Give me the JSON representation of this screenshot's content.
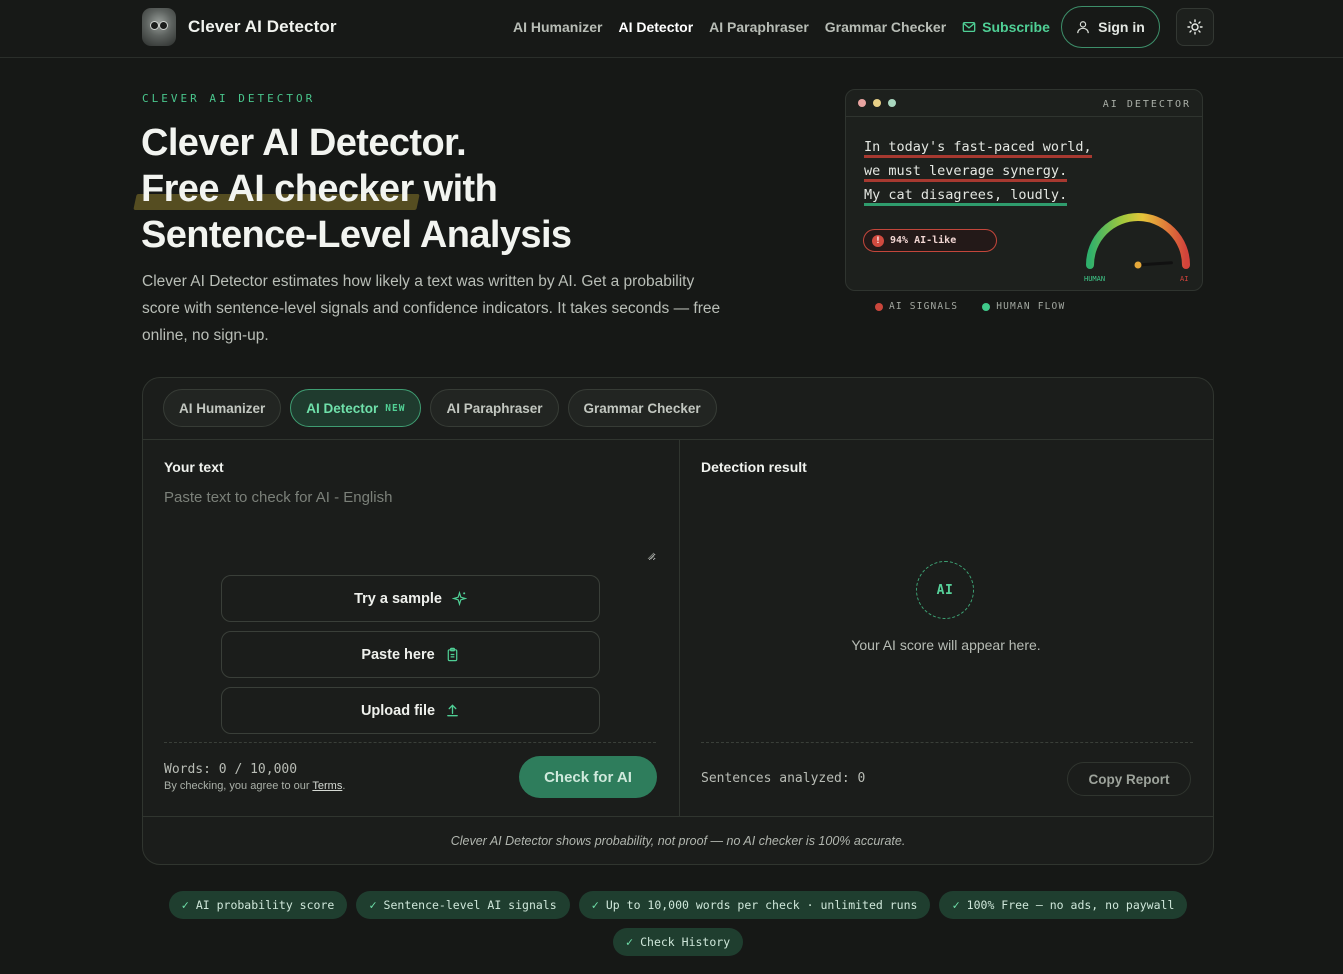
{
  "header": {
    "brand": "Clever AI Detector",
    "nav": [
      {
        "label": "AI Humanizer",
        "active": false
      },
      {
        "label": "AI Detector",
        "active": true
      },
      {
        "label": "AI Paraphraser",
        "active": false
      },
      {
        "label": "Grammar Checker",
        "active": false
      }
    ],
    "subscribe": "Subscribe",
    "sign_in": "Sign in",
    "theme_icon": "sun-icon"
  },
  "hero": {
    "eyebrow": "CLEVER AI DETECTOR",
    "title_line1": "Clever AI Detector.",
    "title_line2_highlight": "Free AI checker",
    "title_line2_rest": " with",
    "title_line3": "Sentence-Level Analysis",
    "description": "Clever AI Detector estimates how likely a text was written by AI. Get a probability score with sentence-level signals and confidence indicators. It takes seconds — free online, no sign-up."
  },
  "preview": {
    "label": "AI DETECTOR",
    "dot_colors": [
      "#e8a3a0",
      "#e7cf86",
      "#a9d7bf"
    ],
    "lines": [
      {
        "text": "In today's fast-paced world,",
        "signal": "ai"
      },
      {
        "text": "we must leverage synergy.",
        "signal": "ai"
      },
      {
        "text": "My cat disagrees, loudly.",
        "signal": "human"
      }
    ],
    "badge": "94% AI-like",
    "badge_icon": "!",
    "gauge": {
      "value": 0.94,
      "left_label": "HUMAN",
      "right_label": "AI"
    },
    "legend": [
      {
        "label": "AI SIGNALS",
        "color": "#c9463b"
      },
      {
        "label": "HUMAN FLOW",
        "color": "#3fc98a"
      }
    ]
  },
  "tool": {
    "tabs": [
      {
        "label": "AI Humanizer",
        "active": false,
        "badge": ""
      },
      {
        "label": "AI Detector",
        "active": true,
        "badge": "NEW"
      },
      {
        "label": "AI Paraphraser",
        "active": false,
        "badge": ""
      },
      {
        "label": "Grammar Checker",
        "active": false,
        "badge": ""
      }
    ],
    "input": {
      "title": "Your text",
      "placeholder": "Paste text to check for AI - English",
      "value": "",
      "actions": [
        {
          "label": "Try a sample",
          "icon": "sparkle-icon"
        },
        {
          "label": "Paste here",
          "icon": "clipboard-icon"
        },
        {
          "label": "Upload file",
          "icon": "upload-icon"
        }
      ],
      "words": "Words: 0 / 10,000",
      "agree_prefix": "By checking, you agree to our ",
      "agree_link": "Terms",
      "agree_suffix": ".",
      "check_button": "Check for AI"
    },
    "result": {
      "title": "Detection result",
      "circle_label": "AI",
      "hint": "Your AI score will appear here.",
      "sentences": "Sentences analyzed: 0",
      "copy_button": "Copy Report"
    },
    "disclaimer": "Clever AI Detector shows probability, not proof — no AI checker is 100% accurate."
  },
  "features": [
    "AI probability score",
    "Sentence-level AI signals",
    "Up to 10,000 words per check · unlimited runs",
    "100% Free – no ads, no paywall",
    "Check History"
  ],
  "colors": {
    "accent": "#4fcf95",
    "background": "#161816",
    "ai_signal": "#c9463b",
    "human_signal": "#3fc98a"
  }
}
